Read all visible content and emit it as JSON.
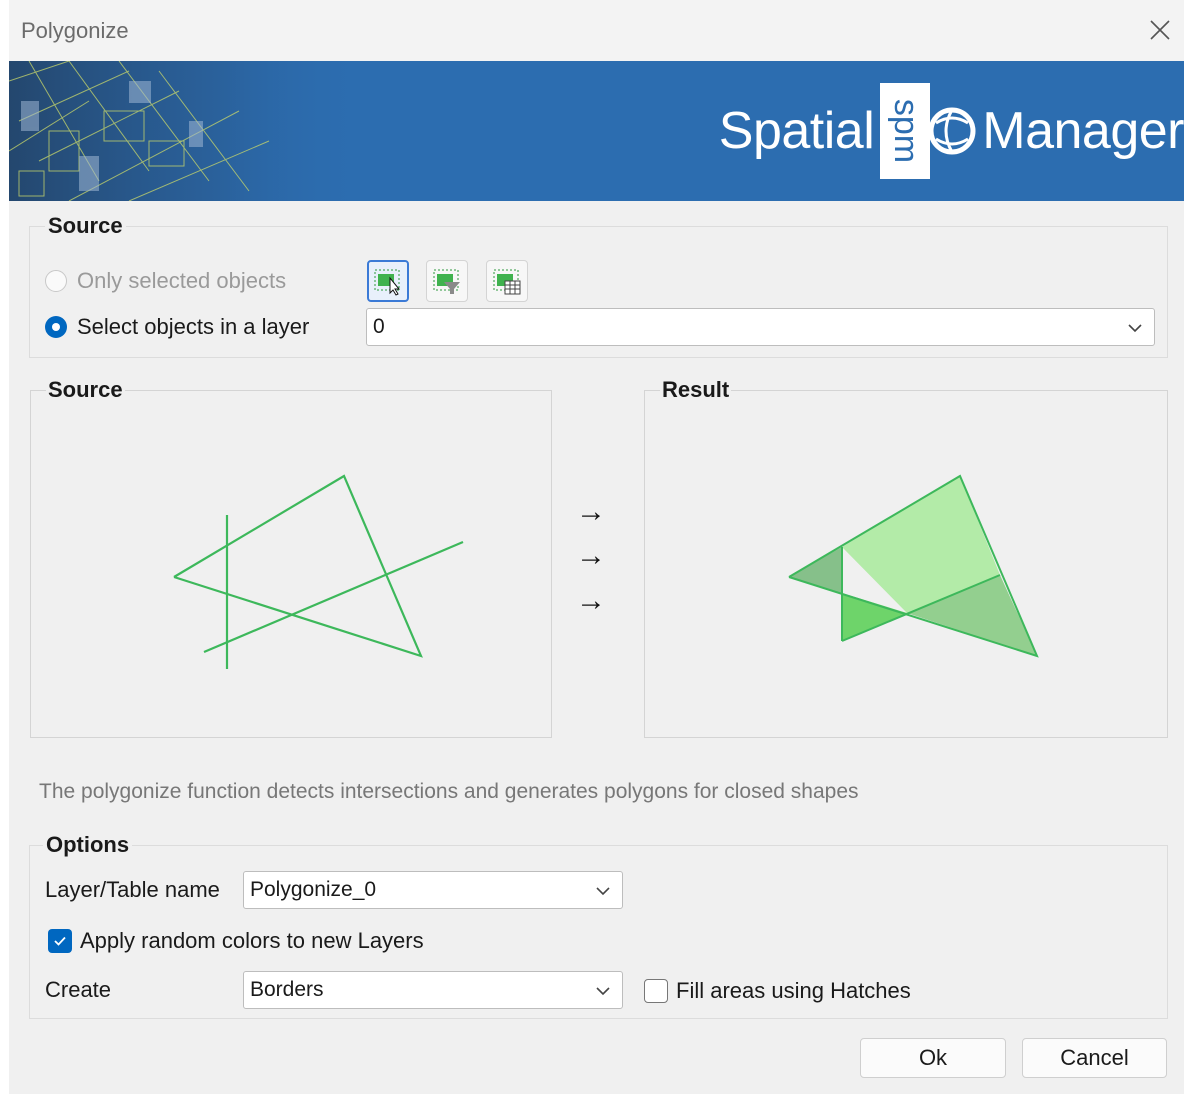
{
  "window": {
    "title": "Polygonize"
  },
  "banner": {
    "brand_left": "Spatial",
    "brand_logo": "spm",
    "brand_right": "Manager"
  },
  "source_group": {
    "label": "Source",
    "radio_selected_label": "Only selected objects",
    "radio_layer_label": "Select objects in a layer",
    "radio_selected_checked": false,
    "radio_layer_checked": true,
    "layer_value": "0",
    "tools": [
      "select-objects-icon",
      "filter-select-icon",
      "table-select-icon"
    ]
  },
  "preview": {
    "source_label": "Source",
    "result_label": "Result",
    "arrows": [
      "→",
      "→",
      "→"
    ]
  },
  "description": "The polygonize function detects intersections and generates polygons for closed shapes",
  "options": {
    "label": "Options",
    "layer_name_label": "Layer/Table name",
    "layer_name_value": "Polygonize_0",
    "random_colors_label": "Apply random colors to new Layers",
    "random_colors_checked": true,
    "create_label": "Create",
    "create_value": "Borders",
    "fill_hatches_label": "Fill areas using Hatches",
    "fill_hatches_checked": false
  },
  "buttons": {
    "ok": "Ok",
    "cancel": "Cancel"
  },
  "colors": {
    "accent": "#0067c0",
    "banner": "#2c6db0",
    "shape_line": "#3db85b"
  }
}
